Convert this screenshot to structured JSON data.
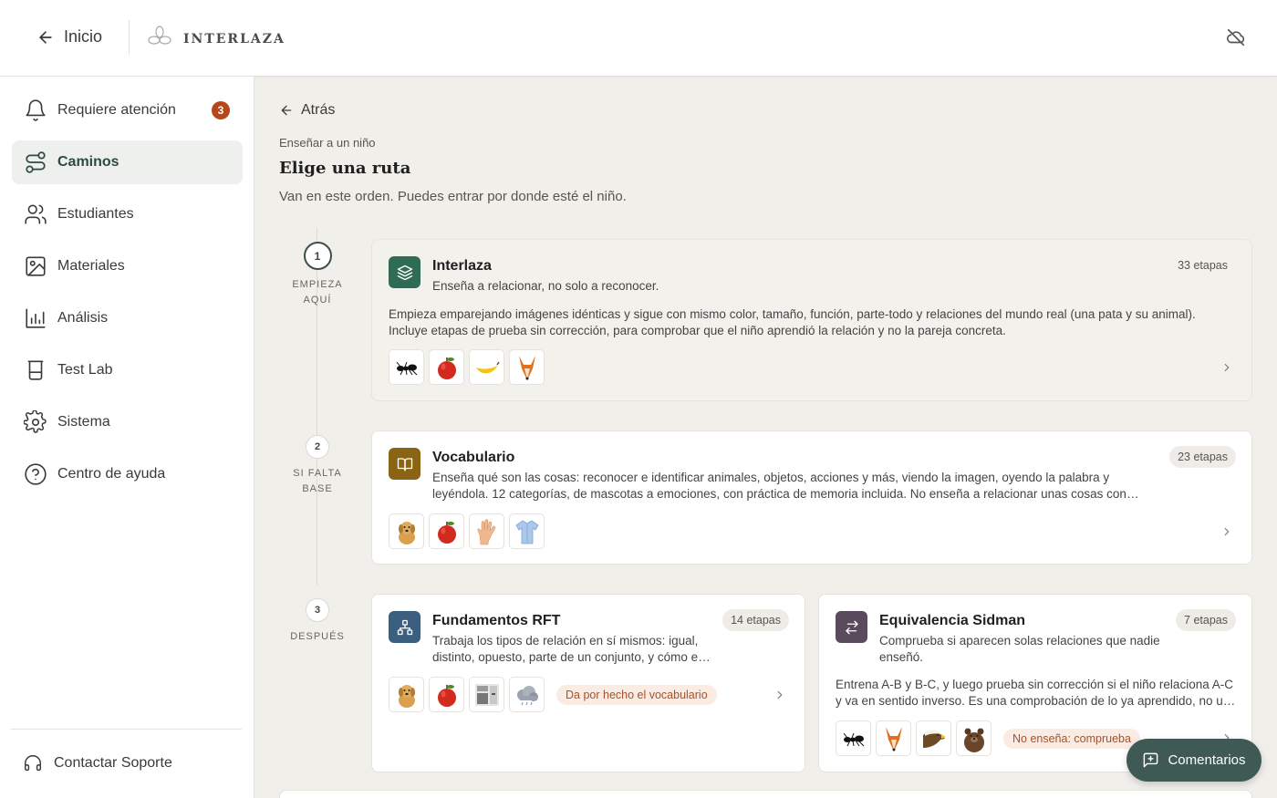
{
  "header": {
    "back_label": "Inicio",
    "brand_name": "INTERLAZA",
    "cloud_icon": "cloud-off-icon"
  },
  "sidebar": {
    "items": [
      {
        "label": "Requiere atención",
        "icon": "bell-icon",
        "badge": "3",
        "active": false
      },
      {
        "label": "Caminos",
        "icon": "route-icon",
        "active": true
      },
      {
        "label": "Estudiantes",
        "icon": "users-icon",
        "active": false
      },
      {
        "label": "Materiales",
        "icon": "image-icon",
        "active": false
      },
      {
        "label": "Análisis",
        "icon": "bar-chart-icon",
        "active": false
      },
      {
        "label": "Test Lab",
        "icon": "beaker-icon",
        "active": false
      },
      {
        "label": "Sistema",
        "icon": "gear-icon",
        "active": false
      },
      {
        "label": "Centro de ayuda",
        "icon": "help-circle-icon",
        "active": false
      }
    ],
    "support_label": "Contactar Soporte"
  },
  "main": {
    "back_label": "Atrás",
    "eyebrow": "Enseñar a un niño",
    "title": "Elige una ruta",
    "subtitle": "Van en este orden. Puedes entrar por donde esté el niño.",
    "steps": [
      {
        "number": "1",
        "label_line1": "EMPIEZA",
        "label_line2": "AQUÍ"
      },
      {
        "number": "2",
        "label_line1": "SI FALTA",
        "label_line2": "BASE"
      },
      {
        "number": "3",
        "label_line1": "DESPUÉS",
        "label_line2": ""
      }
    ],
    "paths": [
      {
        "title": "Interlaza",
        "tagline": "Enseña a relacionar, no solo a reconocer.",
        "stages": "33 etapas",
        "description": "Empieza emparejando imágenes idénticas y sigue con mismo color, tamaño, función, parte-todo y relaciones del mundo real (una pata y su animal). Incluye etapas de prueba sin corrección, para comprobar que el niño aprendió la relación y no la pareja concreta.",
        "thumbnails": [
          "ant",
          "apple",
          "banana",
          "fox"
        ],
        "icon_color": "#2f6b55"
      },
      {
        "title": "Vocabulario",
        "tagline": "Enseña qué son las cosas: reconocer e identificar animales, objetos, acciones y más, viendo la imagen, oyendo la palabra y leyéndola. 12 categorías, de mascotas a emociones, con práctica de memoria incluida. No enseña a relacionar unas cosas con otras; para eso está Interlaza.",
        "stages": "23 etapas",
        "thumbnails": [
          "dog",
          "apple",
          "hand",
          "shirt"
        ],
        "icon_color": "#8a6414"
      },
      {
        "title": "Fundamentos RFT",
        "tagline": "Trabaja los tipos de relación en sí mismos: igual, distinto, opuesto, parte de un conjunto, y cómo el contexto cambia la relación.",
        "stages": "14 etapas",
        "thumbnails": [
          "dog",
          "apple",
          "kitchen",
          "cloud"
        ],
        "note": "Da por hecho el vocabulario",
        "icon_color": "#3d5f7f"
      },
      {
        "title": "Equivalencia Sidman",
        "tagline": "Comprueba si aparecen solas relaciones que nadie enseñó.",
        "stages": "7 etapas",
        "description": "Entrena A-B y B-C, y luego prueba sin corrección si el niño relaciona A-C y va en sentido inverso. Es una comprobación de lo ya aprendido, no una forma de enseñar.",
        "thumbnails": [
          "ant",
          "fox",
          "eagle",
          "bear"
        ],
        "note": "No enseña: comprueba",
        "icon_color": "#5a4a5e"
      }
    ]
  },
  "feedback_button": "Comentarios"
}
